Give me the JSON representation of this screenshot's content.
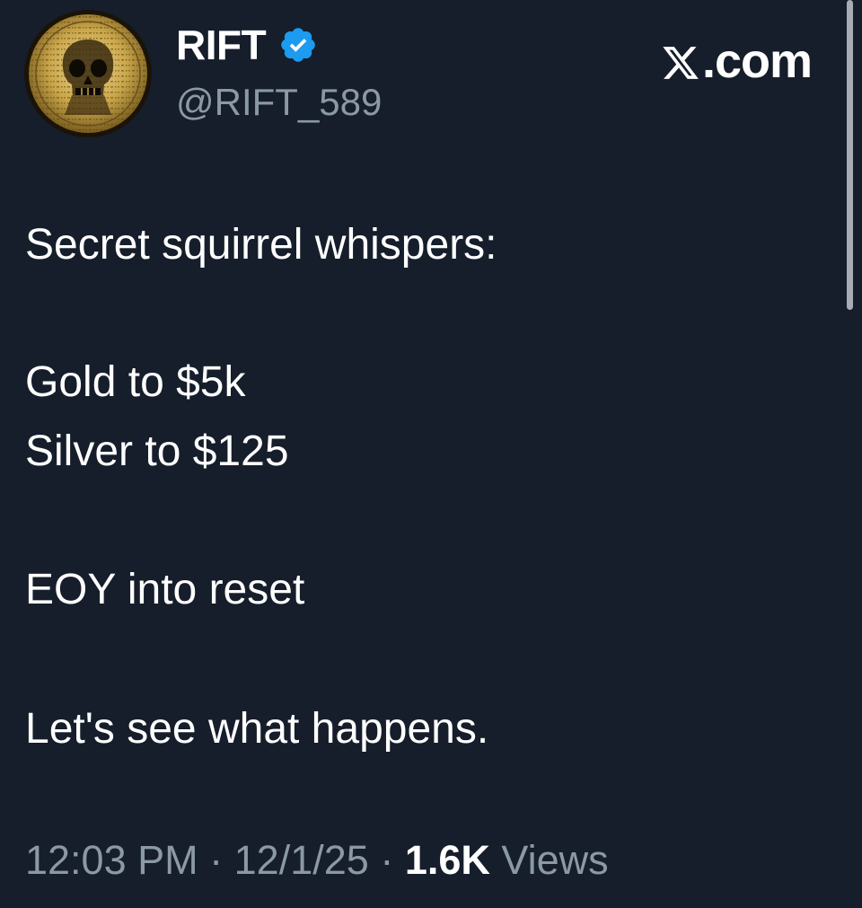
{
  "author": {
    "display_name": "RIFT",
    "handle": "@RIFT_589",
    "verified_icon": "verified-badge-icon",
    "avatar_icon": "coin-skull-avatar"
  },
  "brand": {
    "label": ".com",
    "icon": "x-logo-icon"
  },
  "tweet": {
    "lines": [
      "Secret squirrel whispers:",
      "Gold to $5k",
      "Silver to $125",
      "EOY into reset",
      "Let's see what happens."
    ]
  },
  "meta": {
    "time": "12:03 PM",
    "separator": "·",
    "date": "12/1/25",
    "views_count": "1.6K",
    "views_label": "Views"
  },
  "colors": {
    "background": "#161e2b",
    "text_primary": "#ffffff",
    "text_secondary": "#8b98a5",
    "verified_blue": "#1d9bf0",
    "coin_gold": "#c9a64a"
  }
}
